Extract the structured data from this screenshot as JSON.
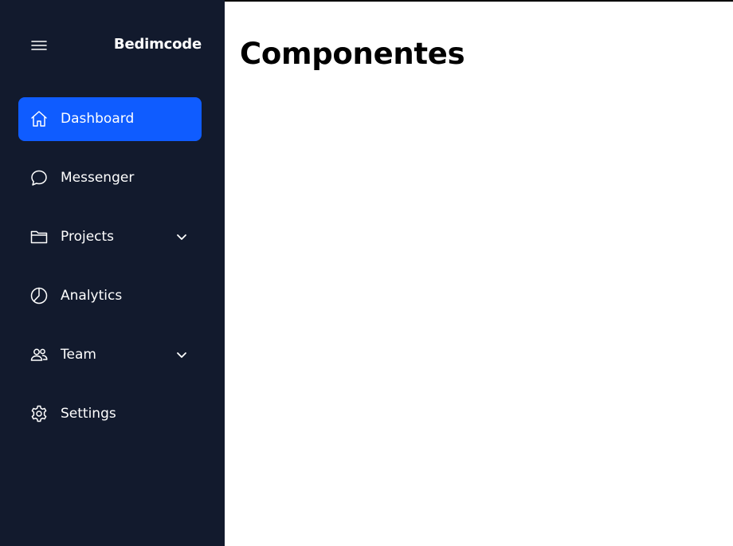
{
  "brand": "Bedimcode",
  "menu_icon": "hamburger-menu-icon",
  "colors": {
    "sidebar_bg": "#121a2d",
    "active_item_bg": "#0f5cff",
    "main_bg": "#ffffff",
    "text_light": "#ffffff",
    "text_dark": "#000000"
  },
  "nav": {
    "items": [
      {
        "label": "Dashboard",
        "icon": "home-icon",
        "active": true,
        "has_dropdown": false
      },
      {
        "label": "Messenger",
        "icon": "chat-bubble-icon",
        "active": false,
        "has_dropdown": false
      },
      {
        "label": "Projects",
        "icon": "folder-icon",
        "active": false,
        "has_dropdown": true
      },
      {
        "label": "Analytics",
        "icon": "pie-chart-icon",
        "active": false,
        "has_dropdown": false
      },
      {
        "label": "Team",
        "icon": "users-icon",
        "active": false,
        "has_dropdown": true
      },
      {
        "label": "Settings",
        "icon": "gear-icon",
        "active": false,
        "has_dropdown": false
      }
    ]
  },
  "main": {
    "title": "Componentes"
  }
}
